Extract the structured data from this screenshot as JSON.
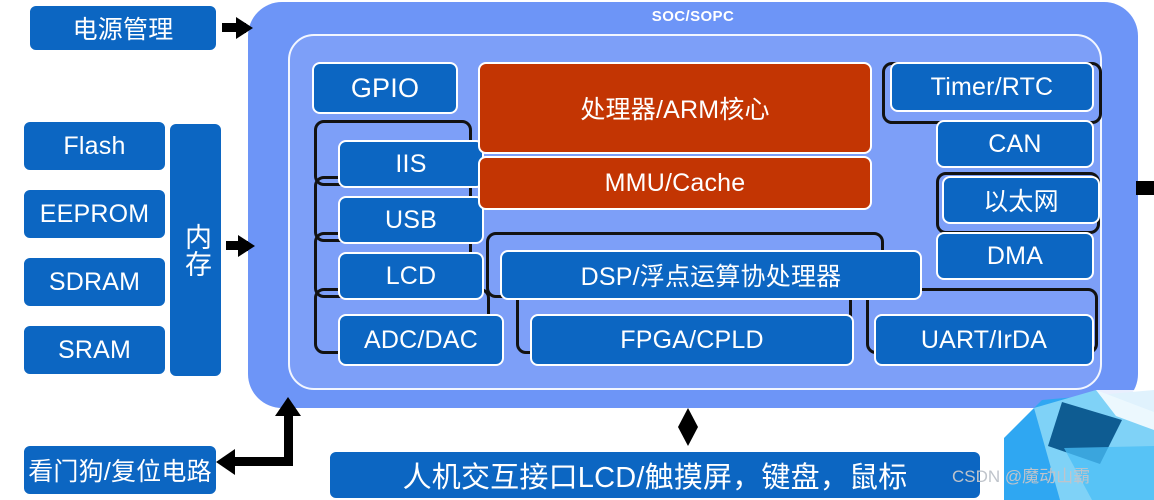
{
  "diagram": {
    "title": "SOC/SOPC",
    "power": {
      "label": "电源管理"
    },
    "memory": {
      "group_label": "内存",
      "items": [
        {
          "label": "Flash"
        },
        {
          "label": "EEPROM"
        },
        {
          "label": "SDRAM"
        },
        {
          "label": "SRAM"
        }
      ]
    },
    "core": [
      {
        "label": "处理器/ARM核心",
        "color": "#C33503"
      },
      {
        "label": "MMU/Cache",
        "color": "#C33503"
      }
    ],
    "left_column": [
      {
        "label": "GPIO"
      },
      {
        "label": "IIS"
      },
      {
        "label": "USB"
      },
      {
        "label": "LCD"
      },
      {
        "label": "ADC/DAC"
      }
    ],
    "right_column": [
      {
        "label": "Timer/RTC"
      },
      {
        "label": "CAN"
      },
      {
        "label": "以太网"
      },
      {
        "label": "DMA"
      },
      {
        "label": "UART/IrDA"
      }
    ],
    "middle": [
      {
        "label": "DSP/浮点运算协处理器"
      },
      {
        "label": "FPGA/CPLD"
      }
    ],
    "bottom_bar": {
      "label": "人机交互接口LCD/触摸屏，键盘，鼠标"
    },
    "watchdog": {
      "label": "看门狗/复位电路"
    },
    "colors": {
      "box_blue": "#0C66C2",
      "box_red": "#C33503",
      "soc_outer": "#6D95F7",
      "soc_inner": "#7D9FF8",
      "arrow": "#000000",
      "text": "#FFFFFF"
    }
  },
  "watermark": {
    "text": "CSDN @魔动山霸"
  }
}
